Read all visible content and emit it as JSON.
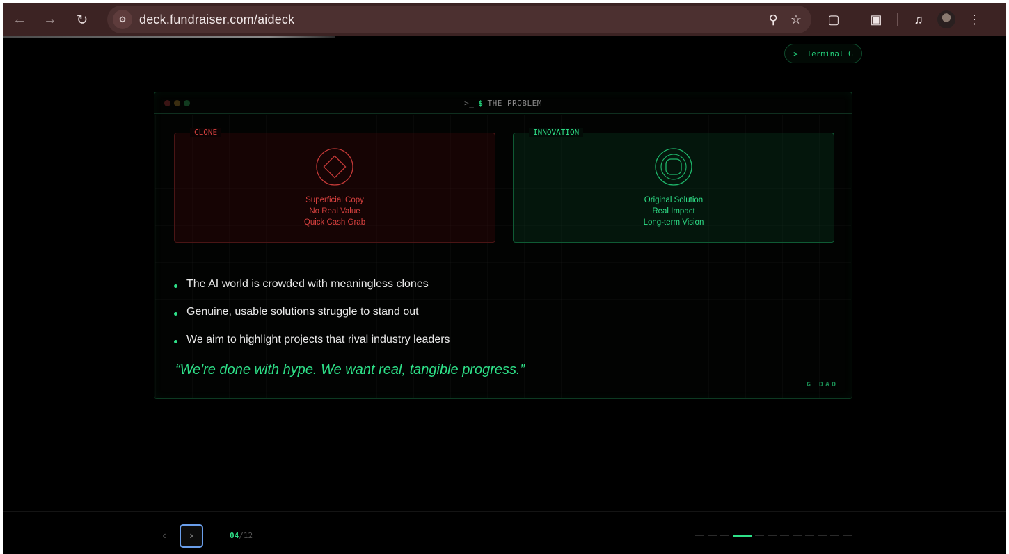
{
  "browser": {
    "url": "deck.fundraiser.com/aideck",
    "icons": [
      "back-arrow-icon",
      "forward-arrow-icon",
      "reload-icon",
      "site-settings-icon",
      "zoom-icon",
      "bookmark-star-icon",
      "extensions-icon",
      "tab-search-icon",
      "media-controls-icon",
      "profile-avatar",
      "more-menu-icon"
    ]
  },
  "header": {
    "terminal_button": "Terminal G",
    "terminal_prompt": ">_"
  },
  "window": {
    "prompt": ">_",
    "dollar": "$",
    "title": "THE PROBLEM",
    "clone": {
      "label": "CLONE",
      "lines": [
        "Superficial Copy",
        "No Real Value",
        "Quick Cash Grab"
      ],
      "color": "#d8413f"
    },
    "innovation": {
      "label": "INNOVATION",
      "lines": [
        "Original Solution",
        "Real Impact",
        "Long-term Vision"
      ],
      "color": "#2ee088"
    },
    "bullets": [
      "The AI world is crowded with meaningless clones",
      "Genuine, usable solutions struggle to stand out",
      "We aim to highlight projects that rival industry leaders"
    ],
    "quote": "“We're done with hype. We want real, tangible progress.”",
    "signature": "G DAO"
  },
  "footer": {
    "current_page": "04",
    "total_pages": "/12",
    "progress_total": 12,
    "progress_active_index": 3,
    "accent": "#2ee088"
  }
}
